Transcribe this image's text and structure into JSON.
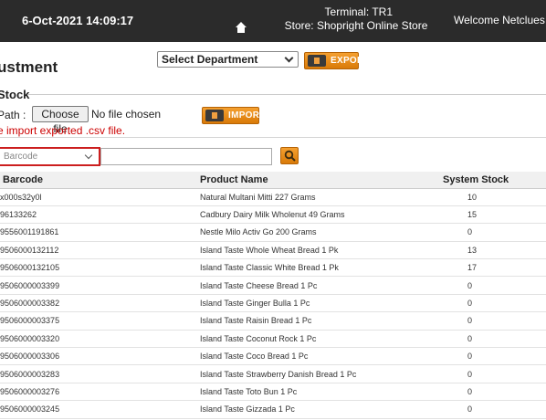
{
  "header": {
    "datetime": "6-Oct-2021 14:09:17",
    "terminal": "Terminal: TR1",
    "store": "Store: Shopright Online Store",
    "welcome": "Welcome Netclues Us",
    "home_icon": "home-icon"
  },
  "page": {
    "title": "ustment"
  },
  "toolbar": {
    "department_select": "Select Department",
    "export_label": "EXPORT",
    "export_icon": "export-icon"
  },
  "stock": {
    "section_label": "Stock",
    "path_label": "Path :",
    "choose_file_label": "Choose file",
    "no_file_text": "No file chosen",
    "import_label": "IMPORT",
    "import_icon": "import-icon",
    "note": "e import exported .csv file."
  },
  "filter": {
    "field_select": "Barcode",
    "search_value": "",
    "search_icon": "search-icon"
  },
  "table": {
    "columns": [
      "Barcode",
      "Product Name",
      "System Stock"
    ],
    "rows": [
      [
        "x000s32y0l",
        "Natural Multani Mitti 227 Grams",
        "10"
      ],
      [
        "96133262",
        "Cadbury Dairy Milk Wholenut 49 Grams",
        "15"
      ],
      [
        "9556001191861",
        "Nestle Milo Activ Go 200 Grams",
        "0"
      ],
      [
        "9506000132112",
        "Island Taste Whole Wheat Bread 1 Pk",
        "13"
      ],
      [
        "9506000132105",
        "Island Taste Classic White Bread 1 Pk",
        "17"
      ],
      [
        "9506000003399",
        "Island Taste Cheese Bread 1 Pc",
        "0"
      ],
      [
        "9506000003382",
        "Island Taste Ginger Bulla 1 Pc",
        "0"
      ],
      [
        "9506000003375",
        "Island Taste Raisin Bread 1 Pc",
        "0"
      ],
      [
        "9506000003320",
        "Island Taste Coconut Rock 1 Pc",
        "0"
      ],
      [
        "9506000003306",
        "Island Taste Coco Bread 1 Pc",
        "0"
      ],
      [
        "9506000003283",
        "Island Taste Strawberry Danish Bread 1 Pc",
        "0"
      ],
      [
        "9506000003276",
        "Island Taste Toto Bun 1 Pc",
        "0"
      ],
      [
        "9506000003245",
        "Island Taste Gizzada 1 Pc",
        "0"
      ]
    ]
  },
  "colors": {
    "header_bg": "#2b2b2b",
    "accent_orange": "#e98c14",
    "error_red": "#cc0000",
    "highlight_border": "#cc1f1f"
  }
}
